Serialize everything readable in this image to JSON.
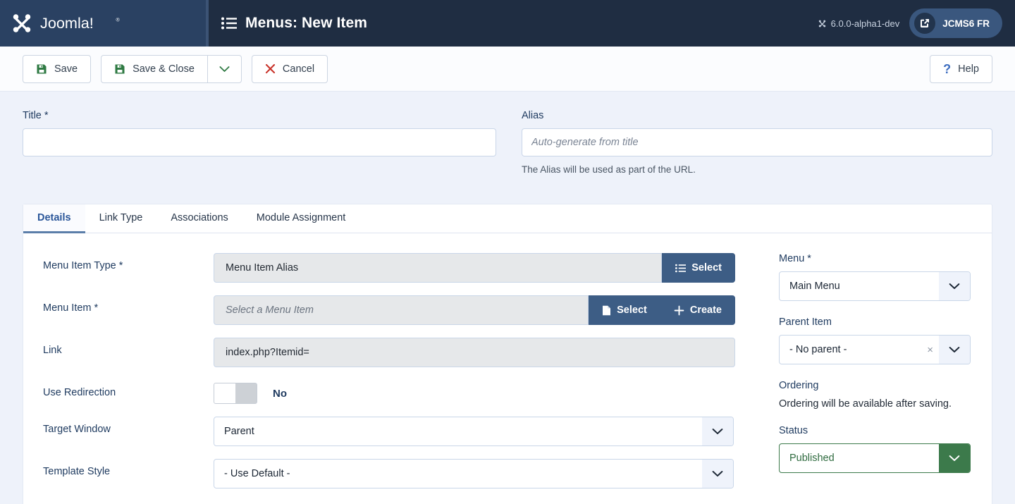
{
  "header": {
    "brand_name": "Joomla!",
    "brand_icon": "joomla-logo",
    "title": "Menus: New Item",
    "title_icon": "list-icon",
    "version": "6.0.0-alpha1-dev",
    "version_icon": "joomla-mark-icon",
    "site_button": "JCMS6 FR",
    "site_button_icon": "external-link-icon"
  },
  "toolbar": {
    "save_label": "Save",
    "save_icon": "floppy-disk-icon",
    "save_close_label": "Save & Close",
    "save_close_icon": "floppy-disk-icon",
    "dropdown_icon": "chevron-down-icon",
    "cancel_label": "Cancel",
    "cancel_icon": "close-x-icon",
    "help_label": "Help",
    "help_icon": "question-mark-icon"
  },
  "top_fields": {
    "title": {
      "label": "Title *",
      "value": "",
      "placeholder": ""
    },
    "alias": {
      "label": "Alias",
      "value": "",
      "placeholder": "Auto-generate from title",
      "help": "The Alias will be used as part of the URL."
    }
  },
  "tabs": [
    {
      "label": "Details",
      "active": true
    },
    {
      "label": "Link Type",
      "active": false
    },
    {
      "label": "Associations",
      "active": false
    },
    {
      "label": "Module Assignment",
      "active": false
    }
  ],
  "details": {
    "menu_item_type": {
      "label": "Menu Item Type *",
      "value": "Menu Item Alias",
      "select_button": "Select",
      "select_button_icon": "list-icon"
    },
    "menu_item": {
      "label": "Menu Item *",
      "placeholder": "Select a Menu Item",
      "select_button": "Select",
      "select_button_icon": "file-icon",
      "create_button": "Create",
      "create_button_icon": "plus-icon"
    },
    "link": {
      "label": "Link",
      "value": "index.php?Itemid="
    },
    "use_redirection": {
      "label": "Use Redirection",
      "state": "No",
      "checked": false
    },
    "target_window": {
      "label": "Target Window",
      "value": "Parent",
      "caret_icon": "chevron-down-icon"
    },
    "template_style": {
      "label": "Template Style",
      "value": "- Use Default -",
      "caret_icon": "chevron-down-icon"
    }
  },
  "sidebar": {
    "menu": {
      "label": "Menu *",
      "value": "Main Menu",
      "caret_icon": "chevron-down-icon"
    },
    "parent_item": {
      "label": "Parent Item",
      "value": "- No parent -",
      "clear_icon": "clear-x-icon",
      "caret_icon": "chevron-down-icon"
    },
    "ordering": {
      "label": "Ordering",
      "note": "Ordering will be available after saving."
    },
    "status": {
      "label": "Status",
      "value": "Published",
      "caret_icon": "chevron-down-icon"
    }
  },
  "colors": {
    "brand_dark": "#1f2d42",
    "brand_mid": "#2a4162",
    "accent_blue": "#3d5d85",
    "link_blue": "#2a5699",
    "success_green": "#3c7a4b",
    "danger_red": "#c9342b",
    "page_bg": "#eef2fa"
  }
}
